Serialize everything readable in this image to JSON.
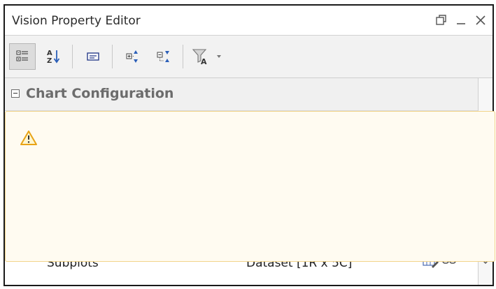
{
  "window": {
    "title": "Vision Property Editor"
  },
  "toolbar": {
    "buttons": [
      {
        "name": "categorized-view",
        "active": true
      },
      {
        "name": "alphabetical-sort"
      },
      {
        "name": "property-pages"
      },
      {
        "name": "expand-all"
      },
      {
        "name": "collapse-all"
      },
      {
        "name": "filter"
      }
    ]
  },
  "grid": {
    "section_title": "Chart Configuration",
    "rows": [
      {
        "name": "Subplots",
        "value": "Dataset [1R x 5C]"
      }
    ]
  },
  "colors": {
    "warning_background": "#fffbf1",
    "warning_border": "#f2d48a",
    "warning_icon": "#e8a317"
  }
}
